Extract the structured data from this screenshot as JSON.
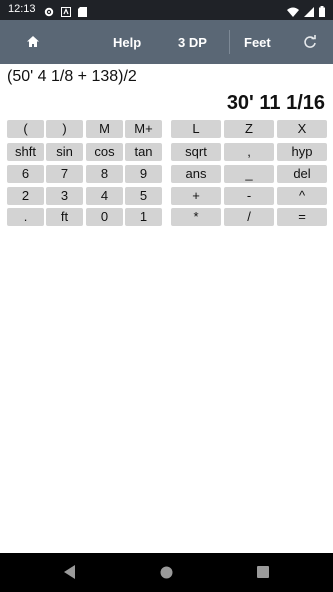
{
  "status": {
    "time": "12:13"
  },
  "toolbar": {
    "home_icon": "home-icon",
    "help": "Help",
    "dp": "3 DP",
    "units": "Feet",
    "refresh_icon": "refresh-icon"
  },
  "display": {
    "expression": "(50' 4 1/8 + 138)/2",
    "result": "30' 11 1/16"
  },
  "keypad_left": [
    [
      "(",
      ")",
      "M",
      "M+"
    ],
    [
      "shft",
      "sin",
      "cos",
      "tan"
    ],
    [
      "6",
      "7",
      "8",
      "9"
    ],
    [
      "2",
      "3",
      "4",
      "5"
    ],
    [
      ".",
      "ft",
      "0",
      "1"
    ]
  ],
  "keypad_right": [
    [
      "L",
      "Z",
      "X"
    ],
    [
      "sqrt",
      ",",
      "hyp"
    ],
    [
      "ans",
      "_",
      "del"
    ],
    [
      "+",
      "-",
      "^"
    ],
    [
      "*",
      "/",
      "="
    ]
  ]
}
